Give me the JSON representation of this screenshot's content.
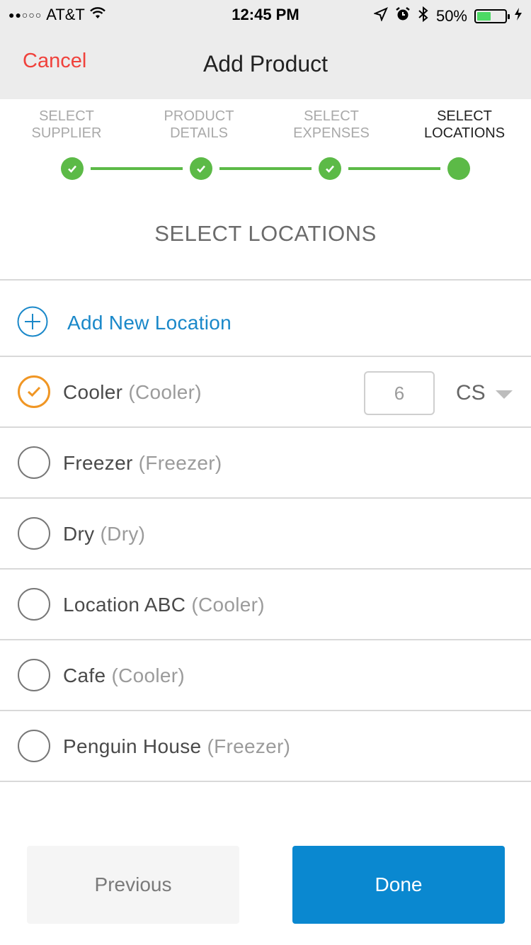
{
  "status_bar": {
    "signal": "●●○○○",
    "carrier": "AT&T",
    "time": "12:45 PM",
    "battery_percent": "50%",
    "battery_level": 0.5,
    "icons": [
      "wifi-icon",
      "location-arrow-icon",
      "alarm-icon",
      "bluetooth-icon",
      "battery-icon",
      "charging-bolt-icon"
    ]
  },
  "nav": {
    "cancel_label": "Cancel",
    "title": "Add Product"
  },
  "steps": [
    {
      "line1": "SELECT",
      "line2": "SUPPLIER",
      "completed": true
    },
    {
      "line1": "PRODUCT",
      "line2": "DETAILS",
      "completed": true
    },
    {
      "line1": "SELECT",
      "line2": "EXPENSES",
      "completed": true
    },
    {
      "line1": "SELECT",
      "line2": "LOCATIONS",
      "completed": false,
      "active": true
    }
  ],
  "section_title": "SELECT LOCATIONS",
  "add_location_label": "Add New Location",
  "locations": [
    {
      "name": "Cooler",
      "type": "(Cooler)",
      "selected": true,
      "quantity": "6",
      "unit": "CS"
    },
    {
      "name": "Freezer",
      "type": "(Freezer)",
      "selected": false
    },
    {
      "name": "Dry",
      "type": "(Dry)",
      "selected": false
    },
    {
      "name": "Location ABC",
      "type": "(Cooler)",
      "selected": false
    },
    {
      "name": "Cafe",
      "type": "(Cooler)",
      "selected": false
    },
    {
      "name": "Penguin House",
      "type": "(Freezer)",
      "selected": false
    }
  ],
  "buttons": {
    "previous_label": "Previous",
    "done_label": "Done"
  },
  "colors": {
    "cancel": "#f0413b",
    "step_green": "#5cba47",
    "link_blue": "#1a88c9",
    "selected_orange": "#f09624",
    "done_blue": "#0a88d0"
  }
}
